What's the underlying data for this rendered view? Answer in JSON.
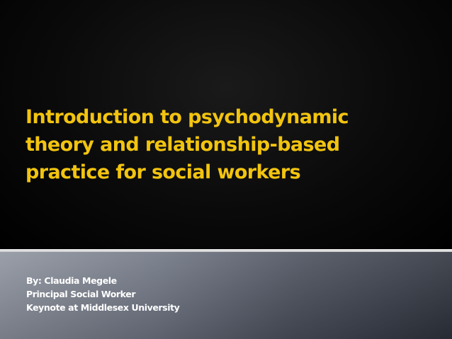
{
  "slide": {
    "title": "Introduction to psychodynamic\ntheory and relationship-based\npractice for social workers",
    "subtitle_lines": [
      "By: Claudia Megele",
      "Principal Social Worker",
      "Keynote at Middlesex University"
    ]
  },
  "colors": {
    "title": "#f2c40f",
    "top_background": "#000000",
    "divider": "#e0e0e0",
    "bottom_background": "#6f7583",
    "subtitle": "#ffffff"
  }
}
